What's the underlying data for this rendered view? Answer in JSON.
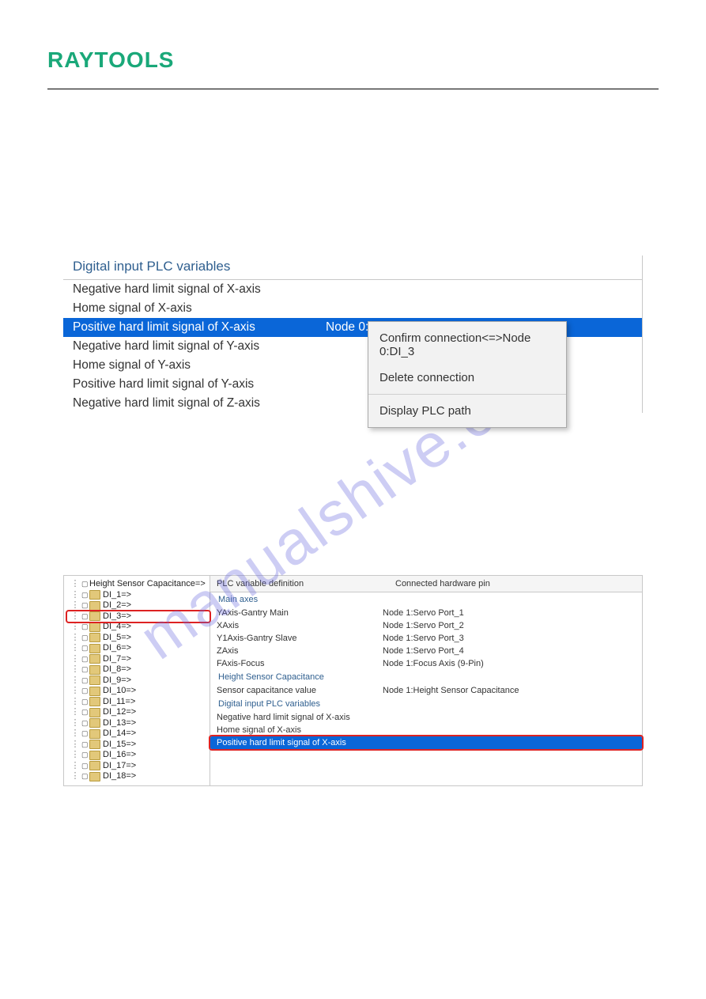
{
  "logo": {
    "part1": "RAY",
    "part2": "TOOLS"
  },
  "watermark": "manualshive.com",
  "shot1": {
    "section_title": "Digital input PLC variables",
    "rows": [
      {
        "label": "Negative hard limit signal of X-axis",
        "value": "",
        "selected": false
      },
      {
        "label": "Home signal of X-axis",
        "value": "",
        "selected": false
      },
      {
        "label": "Positive hard limit signal of X-axis",
        "value": "Node 0:DI_3",
        "selected": true
      },
      {
        "label": "Negative hard limit signal of Y-axis",
        "value": "",
        "selected": false
      },
      {
        "label": "Home signal of Y-axis",
        "value": "",
        "selected": false
      },
      {
        "label": "Positive hard limit signal of Y-axis",
        "value": "",
        "selected": false
      },
      {
        "label": "Negative hard limit signal of Z-axis",
        "value": "",
        "selected": false
      }
    ],
    "context_menu": {
      "confirm": "Confirm connection<=>Node 0:DI_3",
      "delete": "Delete connection",
      "display": "Display PLC path"
    }
  },
  "shot2": {
    "tree": {
      "root": "Height Sensor Capacitance=>",
      "items": [
        {
          "label": "DI_1=>",
          "selected": false
        },
        {
          "label": "DI_2=>",
          "selected": false
        },
        {
          "label": "DI_3=>",
          "selected": true
        },
        {
          "label": "DI_4=>",
          "selected": false
        },
        {
          "label": "DI_5=>",
          "selected": false
        },
        {
          "label": "DI_6=>",
          "selected": false
        },
        {
          "label": "DI_7=>",
          "selected": false
        },
        {
          "label": "DI_8=>",
          "selected": false
        },
        {
          "label": "DI_9=>",
          "selected": false
        },
        {
          "label": "DI_10=>",
          "selected": false
        },
        {
          "label": "DI_11=>",
          "selected": false
        },
        {
          "label": "DI_12=>",
          "selected": false
        },
        {
          "label": "DI_13=>",
          "selected": false
        },
        {
          "label": "DI_14=>",
          "selected": false
        },
        {
          "label": "DI_15=>",
          "selected": false
        },
        {
          "label": "DI_16=>",
          "selected": false
        },
        {
          "label": "DI_17=>",
          "selected": false
        },
        {
          "label": "DI_18=>",
          "selected": false
        }
      ]
    },
    "headers": {
      "a": "PLC variable definition",
      "b": "Connected hardware pin"
    },
    "sections": [
      {
        "title": "Main axes",
        "rows": [
          {
            "a": "YAxis-Gantry Main",
            "b": "Node 1:Servo Port_1"
          },
          {
            "a": "XAxis",
            "b": "Node 1:Servo Port_2"
          },
          {
            "a": "Y1Axis-Gantry Slave",
            "b": "Node 1:Servo Port_3"
          },
          {
            "a": "ZAxis",
            "b": "Node 1:Servo Port_4"
          },
          {
            "a": "FAxis-Focus",
            "b": "Node 1:Focus Axis (9-Pin)"
          }
        ]
      },
      {
        "title": "Height Sensor Capacitance",
        "rows": [
          {
            "a": "Sensor capacitance value",
            "b": "Node 1:Height Sensor Capacitance"
          }
        ]
      },
      {
        "title": "Digital input PLC variables",
        "rows": [
          {
            "a": "Negative hard limit signal of X-axis",
            "b": ""
          },
          {
            "a": "Home signal of X-axis",
            "b": ""
          },
          {
            "a": "Positive hard limit signal of X-axis",
            "b": "",
            "selected": true
          }
        ]
      }
    ]
  }
}
